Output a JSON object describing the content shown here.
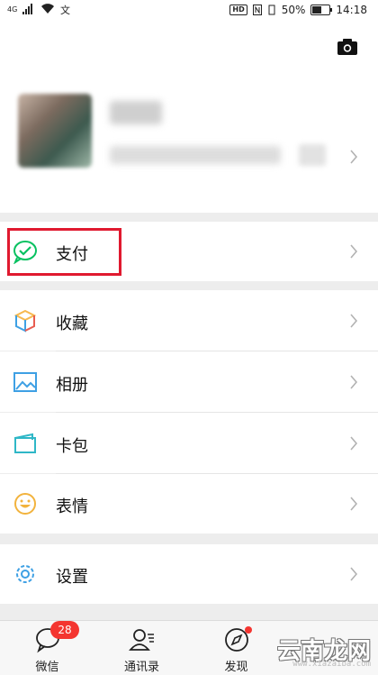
{
  "status_bar": {
    "time": "14:18",
    "battery": "50%",
    "battery_level": 0.5,
    "network": "4G",
    "hd": "HD"
  },
  "menu": {
    "pay": "支付",
    "favorites": "收藏",
    "album": "相册",
    "cards": "卡包",
    "stickers": "表情",
    "settings": "设置"
  },
  "tabs": {
    "chats": {
      "label": "微信",
      "badge": "28"
    },
    "contacts": {
      "label": "通讯录"
    },
    "discover": {
      "label": "发现"
    }
  },
  "watermark": {
    "text": "云南龙网",
    "url": "www.xiazaiba.com"
  },
  "colors": {
    "highlight": "#e0192f",
    "badge": "#f43530",
    "pay_green": "#07c160"
  }
}
